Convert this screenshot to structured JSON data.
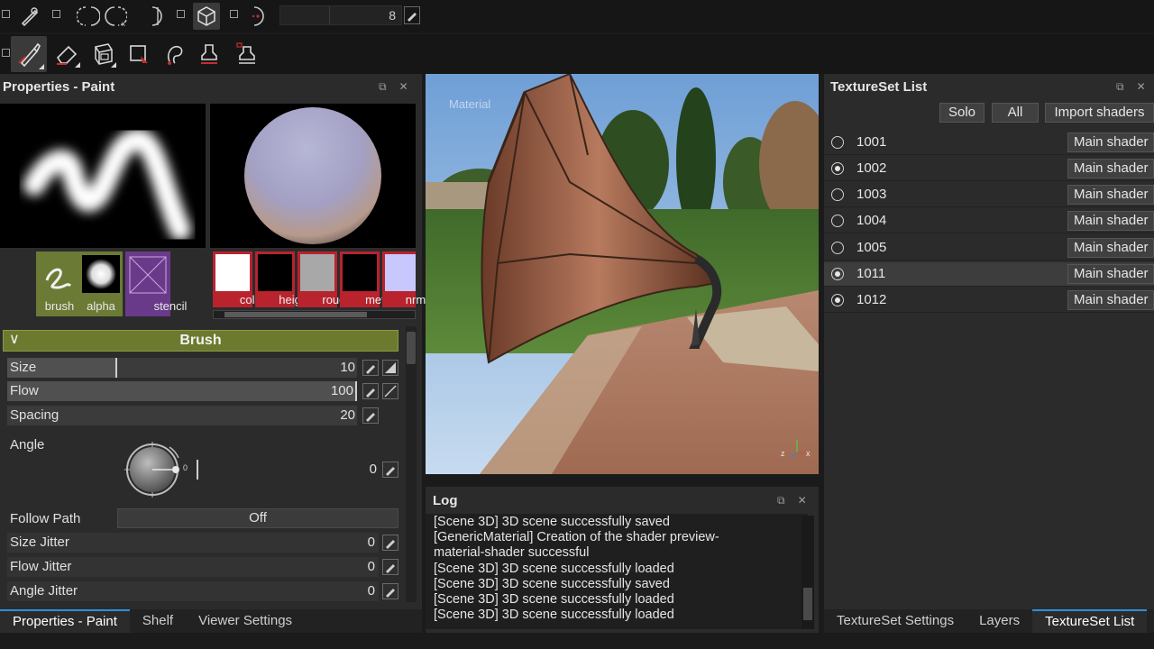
{
  "toolbar_top": {
    "value": "8"
  },
  "properties_panel": {
    "title": "Properties - Paint",
    "swatches": {
      "brush": "brush",
      "alpha": "alpha",
      "stencil": "stencil"
    },
    "channels": [
      {
        "label": "color",
        "swatch_color": "#ffffff"
      },
      {
        "label": "height",
        "swatch_color": "#000000"
      },
      {
        "label": "rough",
        "swatch_color": "#a8a8a8"
      },
      {
        "label": "metal",
        "swatch_color": "#000000"
      },
      {
        "label": "nrm",
        "swatch_color": "#c8c8ff"
      }
    ],
    "brush_section": {
      "title": "Brush",
      "size": {
        "label": "Size",
        "value": "10",
        "fill_fraction": 0.31
      },
      "flow": {
        "label": "Flow",
        "value": "100",
        "fill_fraction": 1.0
      },
      "spacing": {
        "label": "Spacing",
        "value": "20",
        "fill_fraction": 0.0
      },
      "angle": {
        "label": "Angle",
        "value": "0",
        "dial_zero": "0"
      },
      "follow_path": {
        "label": "Follow Path",
        "value": "Off"
      },
      "size_jitter": {
        "label": "Size Jitter",
        "value": "0"
      },
      "flow_jitter": {
        "label": "Flow Jitter",
        "value": "0"
      },
      "angle_jitter": {
        "label": "Angle Jitter",
        "value": "0"
      }
    },
    "tabs": [
      "Properties - Paint",
      "Shelf",
      "Viewer Settings"
    ],
    "active_tab": "Properties - Paint"
  },
  "viewport": {
    "label": "Material",
    "axis_z": "z",
    "axis_x": "x"
  },
  "log_panel": {
    "title": "Log",
    "lines": [
      "[Scene 3D] 3D scene successfully saved",
      "[GenericMaterial] Creation of the shader preview-",
      "material-shader successful",
      "[Scene 3D] 3D scene successfully loaded",
      "[Scene 3D] 3D scene successfully saved",
      "[Scene 3D] 3D scene successfully loaded",
      "[Scene 3D] 3D scene successfully loaded"
    ]
  },
  "texture_set_panel": {
    "title": "TextureSet List",
    "buttons": {
      "solo": "Solo",
      "all": "All",
      "import": "Import shaders"
    },
    "rows": [
      {
        "id": "1001",
        "shader": "Main shader",
        "checked": false,
        "selected": false
      },
      {
        "id": "1002",
        "shader": "Main shader",
        "checked": true,
        "selected": false
      },
      {
        "id": "1003",
        "shader": "Main shader",
        "checked": false,
        "selected": false
      },
      {
        "id": "1004",
        "shader": "Main shader",
        "checked": false,
        "selected": false
      },
      {
        "id": "1005",
        "shader": "Main shader",
        "checked": false,
        "selected": false
      },
      {
        "id": "1011",
        "shader": "Main shader",
        "checked": true,
        "selected": true
      },
      {
        "id": "1012",
        "shader": "Main shader",
        "checked": true,
        "selected": false
      }
    ],
    "tabs": [
      "TextureSet Settings",
      "Layers",
      "TextureSet List"
    ],
    "active_tab": "TextureSet List"
  },
  "colors": {
    "accent_tab": "#2e8fd8",
    "brush_header": "#6b7a2e",
    "channel_red": "#b8232d",
    "stencil_purple": "#6a3a8a"
  }
}
